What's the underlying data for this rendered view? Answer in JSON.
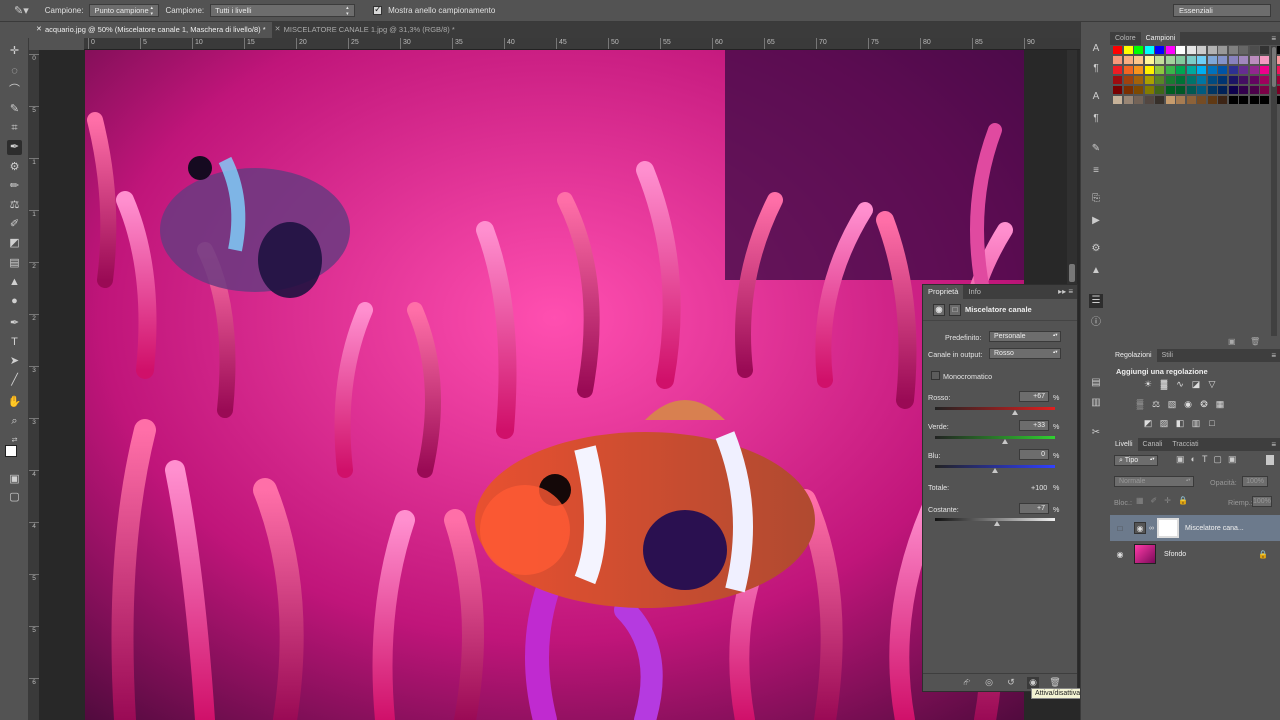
{
  "options_bar": {
    "sample_label": "Campione:",
    "sample_value": "Punto campione",
    "sample2_label": "Campione:",
    "sample2_value": "Tutti i livelli",
    "ring_label": "Mostra anello campionamento",
    "ring_checked": true
  },
  "workspace": "Essenziali",
  "tabs": [
    {
      "label": "acquario.jpg @ 50% (Miscelatore canale 1, Maschera di livello/8) *",
      "active": true
    },
    {
      "label": "MISCELATORE CANALE 1.jpg @ 31,3% (RGB/8) *",
      "active": false
    }
  ],
  "ruler_h": [
    "0",
    "5",
    "10",
    "15",
    "20",
    "25",
    "30",
    "35",
    "40",
    "45",
    "50",
    "55",
    "60",
    "65",
    "70",
    "75",
    "80",
    "85",
    "90"
  ],
  "ruler_v": [
    "0",
    "5",
    "1",
    "1",
    "2",
    "2",
    "3",
    "3",
    "4",
    "4",
    "5",
    "5",
    "6"
  ],
  "properties": {
    "tab1": "Proprietà",
    "tab2": "Info",
    "title": "Miscelatore canale",
    "preset_label": "Predefinito:",
    "preset_value": "Personale",
    "output_label": "Canale in output:",
    "output_value": "Rosso",
    "mono_label": "Monocromatico",
    "mono_checked": false,
    "channels": [
      {
        "label": "Rosso:",
        "value": "+67",
        "level": 0.67,
        "gradient": "red"
      },
      {
        "label": "Verde:",
        "value": "+33",
        "level": 0.33,
        "gradient": "green"
      },
      {
        "label": "Blu:",
        "value": "0",
        "level": 0,
        "gradient": "blue"
      }
    ],
    "total_label": "Totale:",
    "total_value": "+100",
    "constant_label": "Costante:",
    "constant_value": "+7",
    "constant_level": 0.07,
    "percent": "%"
  },
  "tooltip": "Attiva/disattiva la visibilità del livello",
  "swatch_panel": {
    "tab1": "Colore",
    "tab2": "Campioni"
  },
  "adjustments": {
    "tab1": "Regolazioni",
    "tab2": "Stili",
    "title": "Aggiungi una regolazione"
  },
  "layers": {
    "tab1": "Livelli",
    "tab2": "Canali",
    "tab3": "Tracciati",
    "kind": "Tipo",
    "blend": "Normale",
    "opacity_label": "Opacità:",
    "opacity": "100%",
    "lock_label": "Bloc.:",
    "fill_label": "Riemp.:",
    "fill": "100%",
    "items": [
      {
        "name": "Miscelatore cana...",
        "selected": true
      },
      {
        "name": "Sfondo",
        "selected": false
      }
    ]
  }
}
